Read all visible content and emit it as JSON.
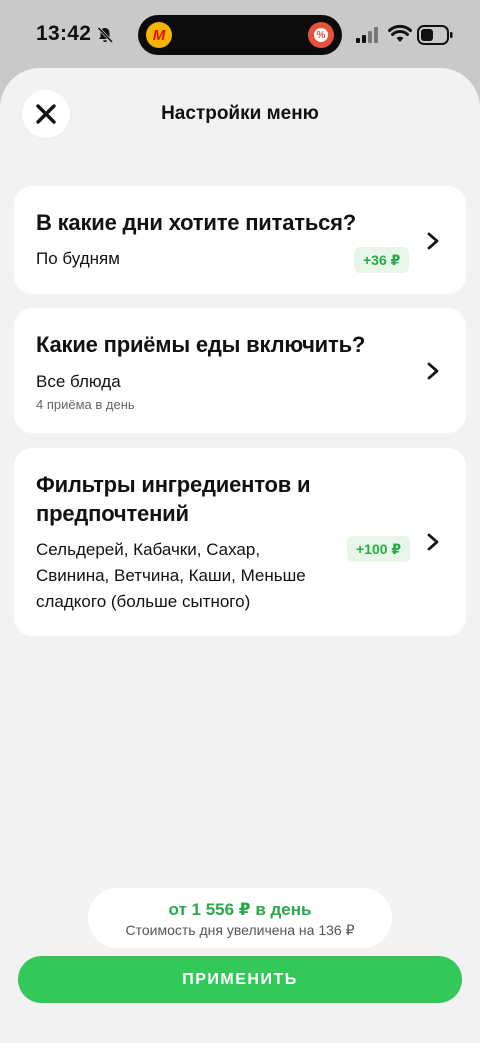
{
  "status_bar": {
    "time": "13:42",
    "icons": [
      "bell-slash-icon",
      "app-icon",
      "discount-icon",
      "signal-icon",
      "wifi-icon",
      "battery-icon"
    ]
  },
  "island": {
    "left_icon_glyph": "M",
    "right_icon_glyph": "%"
  },
  "header": {
    "title": "Настройки меню",
    "close_icon": "close-icon"
  },
  "cards": [
    {
      "title": "В какие дни хотите питаться?",
      "value": "По будням",
      "subtitle": "",
      "badge": "+36 ₽"
    },
    {
      "title": "Какие приёмы еды включить?",
      "value": "Все блюда",
      "subtitle": "4 приёма в день",
      "badge": ""
    },
    {
      "title_line1": "Фильтры ингредиентов и",
      "title_line2": "предпочтений",
      "value_line1": "Сельдерей, Кабачки, Сахар,",
      "value_line2": "Свинина, Ветчина, Каши, Меньше",
      "value_line3": "сладкого (больше сытного)",
      "badge": "+100 ₽"
    }
  ],
  "footer": {
    "price_main": "от 1 556 ₽ в день",
    "price_note": "Стоимость дня увеличена на 136 ₽",
    "apply_label": "ПРИМЕНИТЬ"
  },
  "colors": {
    "accent": "#34c759",
    "price_green": "#2aa94a",
    "badge_bg": "#e7f6e9",
    "sheet_bg": "#f2f2f2",
    "card_bg": "#ffffff"
  }
}
